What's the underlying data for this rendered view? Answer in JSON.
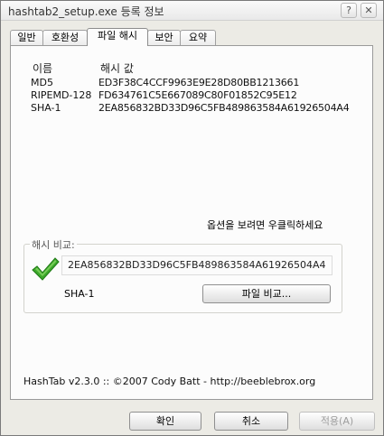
{
  "window": {
    "title": "hashtab2_setup.exe 등록 정보",
    "help_glyph": "?",
    "close_glyph": "✕"
  },
  "tabs": [
    {
      "label": "일반"
    },
    {
      "label": "호환성"
    },
    {
      "label": "파일 해시",
      "active": true
    },
    {
      "label": "보안"
    },
    {
      "label": "요약"
    }
  ],
  "hash_table": {
    "headers": {
      "name": "이름",
      "value": "해시 값"
    },
    "rows": [
      {
        "name": "MD5",
        "value": "ED3F38C4CCF9963E9E28D80BB1213661"
      },
      {
        "name": "RIPEMD-128",
        "value": "FD634761C5E667089C80F01852C95E12"
      },
      {
        "name": "SHA-1",
        "value": "2EA856832BD33D96C5FB489863584A61926504A4"
      }
    ]
  },
  "right_click_hint": "옵션을 보려면 우클릭하세요",
  "compare": {
    "group_label": "해시 비교:",
    "hash_value": "2EA856832BD33D96C5FB489863584A61926504A4",
    "match_icon": "green-check-icon",
    "algorithm": "SHA-1",
    "compare_button": "파일 비교..."
  },
  "credits": "HashTab v2.3.0 :: ©2007 Cody Batt  -  http://beeblebrox.org",
  "buttons": {
    "ok": "확인",
    "cancel": "취소",
    "apply": "적용(A)"
  },
  "colors": {
    "check_green": "#3ca82a",
    "window_bg": "#ecebe5",
    "panel_bg": "#fcfcfc"
  }
}
